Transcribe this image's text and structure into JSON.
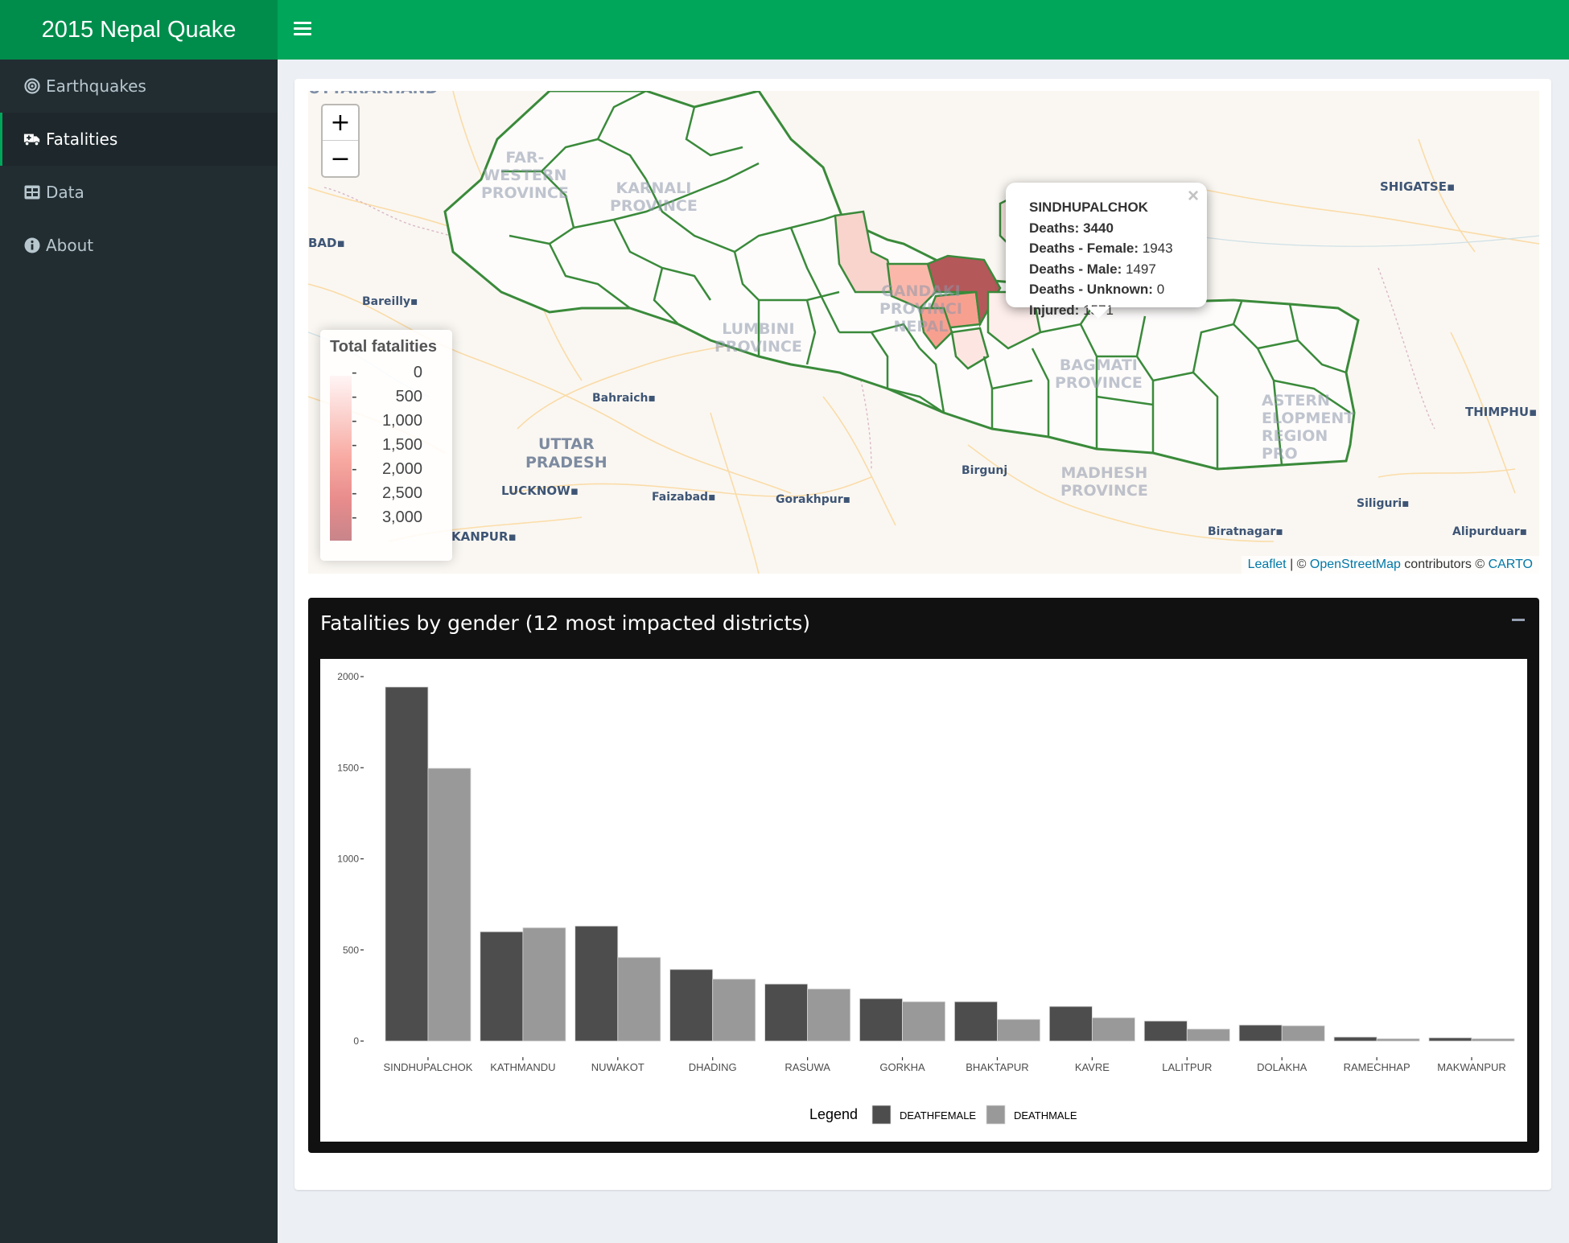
{
  "app": {
    "title": "2015 Nepal Quake",
    "menu_icon": "hamburger-icon"
  },
  "sidebar": {
    "items": [
      {
        "label": "Earthquakes",
        "icon": "bullseye-icon",
        "active": false
      },
      {
        "label": "Fatalities",
        "icon": "ambulance-icon",
        "active": true
      },
      {
        "label": "Data",
        "icon": "table-icon",
        "active": false
      },
      {
        "label": "About",
        "icon": "info-circle-icon",
        "active": false
      }
    ]
  },
  "map": {
    "zoom_in": "+",
    "zoom_out": "−",
    "legend": {
      "title": "Total fatalities",
      "ticks": [
        "0",
        "500",
        "1,000",
        "1,500",
        "2,000",
        "2,500",
        "3,000"
      ]
    },
    "labels": {
      "uttarakhand": "UTTARAKHAND",
      "far_western_1": "FAR-",
      "far_western_2": "WESTERN",
      "far_western_3": "PROVINCE",
      "karnali_1": "KARNALI",
      "karnali_2": "PROVINCE",
      "gandaki_1": "GANDAKI",
      "gandaki_2": "PROVINCI",
      "gandaki_3": "NEPAL",
      "lumbini_1": "LUMBINI",
      "lumbini_2": "PROVINCE",
      "bagmati_1": "BAGMATI",
      "bagmati_2": "PROVINCE",
      "madhesh_1": "MADHESH",
      "madhesh_2": "PROVINCE",
      "eastern_1": "ASTERN",
      "eastern_2": "ELOPMENT",
      "eastern_3": "REGION",
      "eastern_4": "PRO",
      "uttar_1": "UTTAR",
      "uttar_2": "PRADESH",
      "shigatse": "SHIGATSE",
      "thimphu": "THIMPHU",
      "bad": "BAD",
      "bareilly": "Bareilly",
      "bahraich": "Bahraich",
      "lucknow": "LUCKNOW",
      "kanpur": "KANPUR",
      "faizabad": "Faizabad",
      "gorakhpur": "Gorakhpur",
      "birgunj": "Birgunj",
      "siliguri": "Siliguri",
      "biratnagar": "Biratnagar",
      "alipurduar": "Alipurduar"
    },
    "popup": {
      "district": "SINDHUPALCHOK",
      "deaths_label": "Deaths:",
      "deaths": "3440",
      "female_label": "Deaths - Female:",
      "female": "1943",
      "male_label": "Deaths - Male:",
      "male": "1497",
      "unknown_label": "Deaths - Unknown:",
      "unknown": "0",
      "injured_label": "Injured:",
      "injured": "1571",
      "close": "×"
    },
    "attribution": {
      "leaflet": "Leaflet",
      "sep": " | © ",
      "osm": "OpenStreetMap",
      "contrib": " contributors © ",
      "carto": "CARTO"
    },
    "colors": {
      "district_border": "#3a8a3a",
      "high": "#b5585a"
    }
  },
  "chart_box": {
    "title": "Fatalities by gender (12 most impacted districts)",
    "minimize": "−"
  },
  "chart_data": {
    "type": "bar",
    "title": "Fatalities by gender (12 most impacted districts)",
    "xlabel": "",
    "ylabel": "",
    "ylim": [
      0,
      2050
    ],
    "yticks": [
      0,
      500,
      1000,
      1500,
      2000
    ],
    "grid": false,
    "legend_title": "Legend",
    "legend_position": "bottom",
    "categories": [
      "SINDHUPALCHOK",
      "KATHMANDU",
      "NUWAKOT",
      "DHADING",
      "RASUWA",
      "GORKHA",
      "BHAKTAPUR",
      "KAVRE",
      "LALITPUR",
      "DOLAKHA",
      "RAMECHHAP",
      "MAKWANPUR"
    ],
    "series": [
      {
        "name": "DEATHFEMALE",
        "color": "#4d4d4d",
        "values": [
          1943,
          600,
          631,
          393,
          313,
          233,
          216,
          190,
          110,
          88,
          22,
          18
        ]
      },
      {
        "name": "DEATHMALE",
        "color": "#999999",
        "values": [
          1497,
          622,
          459,
          340,
          286,
          216,
          119,
          128,
          66,
          84,
          13,
          13
        ]
      }
    ]
  }
}
